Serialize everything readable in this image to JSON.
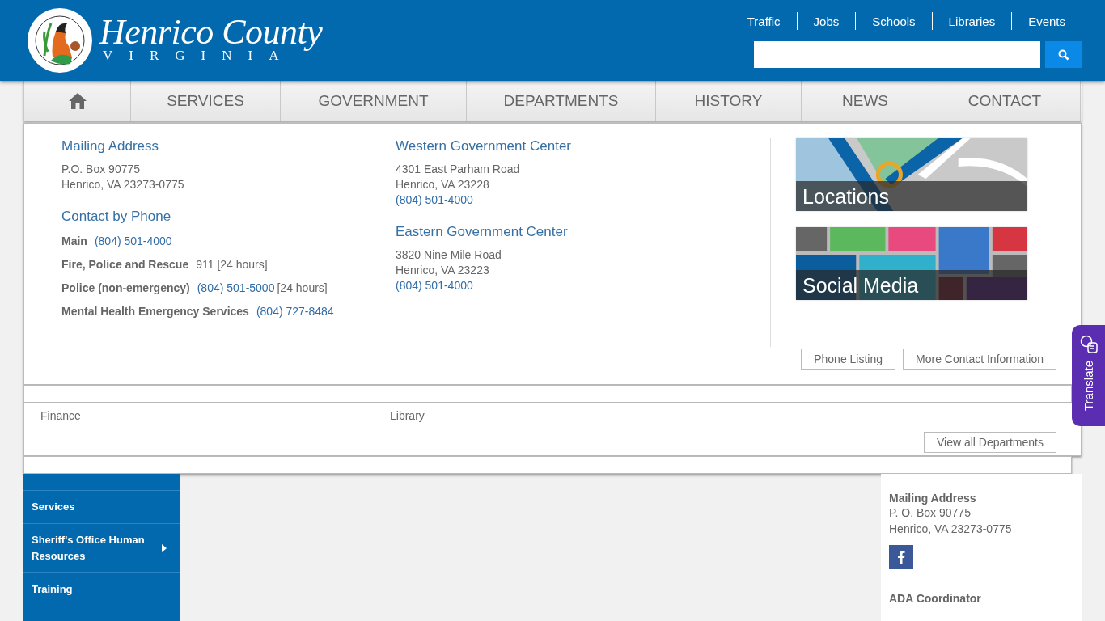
{
  "header": {
    "brand": "Henrico County",
    "subtitle": "VIRGINIA",
    "utility_links": [
      "Traffic",
      "Jobs",
      "Schools",
      "Libraries",
      "Events"
    ]
  },
  "nav": [
    {
      "kind": "home"
    },
    {
      "kind": "text",
      "label": "SERVICES"
    },
    {
      "kind": "text",
      "label": "GOVERNMENT"
    },
    {
      "kind": "text",
      "label": "DEPARTMENTS"
    },
    {
      "kind": "text",
      "label": "HISTORY"
    },
    {
      "kind": "text",
      "label": "NEWS"
    },
    {
      "kind": "text",
      "label": "CONTACT"
    }
  ],
  "contact_menu": {
    "mailing": {
      "heading": "Mailing Address",
      "lines": [
        "P.O. Box 90775",
        "Henrico, VA 23273-0775"
      ]
    },
    "phone": {
      "heading": "Contact by Phone",
      "entries": [
        {
          "label": "Main",
          "number": "(804) 501-4000"
        },
        {
          "label": "Fire, Police and Rescue",
          "note": "911 [24 hours]"
        },
        {
          "label": "Police (non-emergency)",
          "number": "(804) 501-5000",
          "note": "[24 hours]"
        },
        {
          "label": "Mental Health Emergency Services",
          "number": "(804) 727-8484"
        }
      ]
    },
    "centers": [
      {
        "heading": "Western Government Center",
        "lines": [
          "4301 East Parham Road",
          "Henrico, VA 23228"
        ],
        "phone": "(804) 501-4000"
      },
      {
        "heading": "Eastern Government Center",
        "lines": [
          "3820 Nine Mile Road",
          "Henrico, VA 23223"
        ],
        "phone": "(804) 501-4000"
      }
    ],
    "tiles": [
      {
        "kind": "map",
        "label": "Locations"
      },
      {
        "kind": "social",
        "label": "Social Media"
      }
    ],
    "buttons": [
      "Phone Listing",
      "More Contact Information"
    ]
  },
  "departments_menu": {
    "items": [
      "Finance",
      "Library"
    ],
    "button": "View all Departments"
  },
  "sidebar": {
    "items": [
      {
        "label": "Services",
        "has_submenu": false
      },
      {
        "label": "Sheriff's Office Human Resources",
        "has_submenu": true
      },
      {
        "label": "Training",
        "has_submenu": false
      }
    ]
  },
  "aside": {
    "heading": "Mailing Address",
    "lines": [
      "P. O. Box 90775",
      "Henrico, VA 23273-0775"
    ],
    "heading_2": "ADA Coordinator"
  },
  "translate": "Translate"
}
